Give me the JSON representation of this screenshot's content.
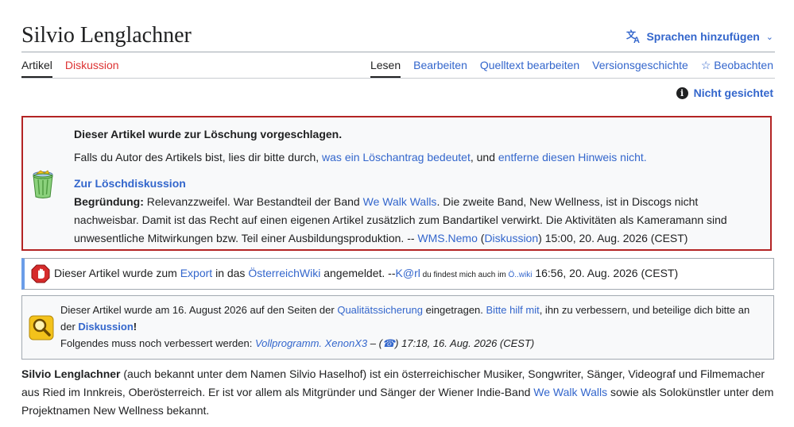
{
  "header": {
    "title": "Silvio Lenglachner",
    "languages_label": "Sprachen hinzufügen",
    "languages_icon": "translate-icon"
  },
  "tabs_left": [
    {
      "label": "Artikel",
      "selected": true
    },
    {
      "label": "Diskussion",
      "selected": false
    }
  ],
  "tabs_right": [
    {
      "label": "Lesen",
      "selected": true
    },
    {
      "label": "Bearbeiten"
    },
    {
      "label": "Quelltext bearbeiten"
    },
    {
      "label": "Versionsgeschichte"
    },
    {
      "label": "Beobachten",
      "icon": "star-outline-icon"
    }
  ],
  "sighting": {
    "label": "Nicht gesichtet",
    "icon": "info-icon"
  },
  "deletion_box": {
    "headline": "Dieser Artikel wurde zur Löschung vorgeschlagen.",
    "p2_prefix": "Falls du Autor des Artikels bist, lies dir bitte durch, ",
    "p2_link1": "was ein Löschantrag bedeutet",
    "p2_mid": ", und ",
    "p2_link2": "entferne diesen Hinweis nicht.",
    "discussion_link": "Zur Löschdiskussion",
    "reason_label": "Begründung:",
    "reason_t1": " Relevanzzweifel. War Bestandteil der Band ",
    "reason_link1": "We Walk Walls",
    "reason_t2": ". Die zweite Band, New Wellness, ist in Discogs nicht nachweisbar. Damit ist das Recht auf einen eigenen Artikel zusätzlich zum Bandartikel verwirkt. Die Aktivitäten als Kameramann sind unwesentliche Mitwirkungen bzw. Teil einer Ausbildungsproduktion. -- ",
    "reason_user": "WMS.Nemo",
    "reason_t3": " (",
    "reason_talk": "Diskussion",
    "reason_t4": ") 15:00, 20. Aug. 2026 (CEST)",
    "icon": "trash-can-icon"
  },
  "export_box": {
    "t1": "Dieser Artikel wurde zum ",
    "link1": "Export",
    "t2": " in das ",
    "link2": "ÖsterreichWiki",
    "t3": " angemeldet. --",
    "user": "K@rl",
    "small_text": " du findest mich auch im ",
    "small_link": "Ö..wiki",
    "t4": " 16:56, 20. Aug. 2026 (CEST)",
    "icon": "stop-sign-icon"
  },
  "qs_box": {
    "t1": "Dieser Artikel wurde am 16. August 2026 auf den Seiten der ",
    "link1": "Qualitätssicherung",
    "t2": " eingetragen. ",
    "link2": "Bitte hilf mit",
    "t3": ", ihn zu verbessern, und beteilige dich bitte an der ",
    "link3": "Diskussion",
    "t4": "!",
    "line2_prefix": "Folgendes muss noch verbessert werden: ",
    "line2_link": "Vollprogramm. XenonX3",
    "line2_mid": " – (",
    "line2_phone": "☎",
    "line2_suffix": ") 17:18, 16. Aug. 2026 (CEST)",
    "icon": "magnifier-icon"
  },
  "intro": {
    "name": "Silvio Lenglachner",
    "t1": " (auch bekannt unter dem Namen Silvio Haselhof) ist ein österreichischer Musiker, Songwriter, Sänger, Videograf und Filmemacher aus Ried im Innkreis, Oberösterreich. Er ist vor allem als Mitgründer und Sänger der Wiener Indie-Band ",
    "link": "We Walk Walls",
    "t2": " sowie als Solokünstler unter dem Projektnamen New Wellness bekannt."
  },
  "colors": {
    "link": "#3366cc",
    "red_link": "#dd3333",
    "deletion_border": "#b32424",
    "export_accent": "#6b9de8"
  }
}
